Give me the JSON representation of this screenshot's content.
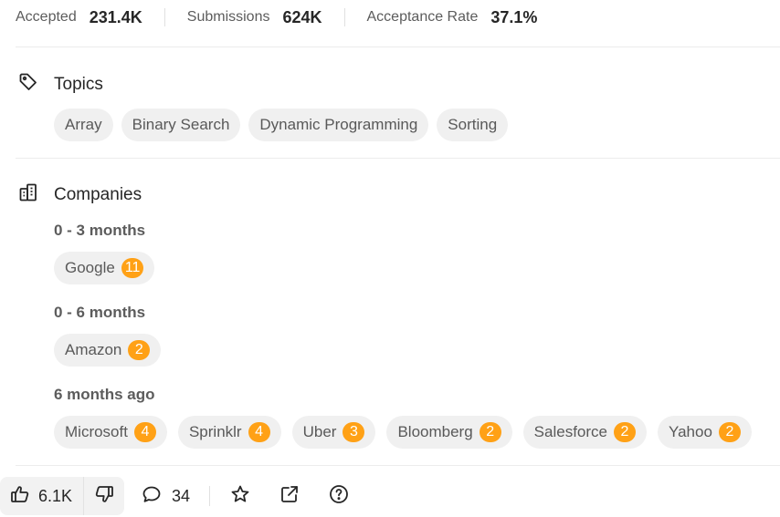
{
  "stats": [
    {
      "label": "Accepted",
      "value": "231.4K"
    },
    {
      "label": "Submissions",
      "value": "624K"
    },
    {
      "label": "Acceptance Rate",
      "value": "37.1%"
    }
  ],
  "topics": {
    "title": "Topics",
    "icon": "tag-icon",
    "tags": [
      "Array",
      "Binary Search",
      "Dynamic Programming",
      "Sorting"
    ]
  },
  "companies": {
    "title": "Companies",
    "icon": "building-icon",
    "groups": [
      {
        "period": "0 - 3 months",
        "items": [
          {
            "name": "Google",
            "count": "11"
          }
        ]
      },
      {
        "period": "0 - 6 months",
        "items": [
          {
            "name": "Amazon",
            "count": "2"
          }
        ]
      },
      {
        "period": "6 months ago",
        "items": [
          {
            "name": "Microsoft",
            "count": "4"
          },
          {
            "name": "Sprinklr",
            "count": "4"
          },
          {
            "name": "Uber",
            "count": "3"
          },
          {
            "name": "Bloomberg",
            "count": "2"
          },
          {
            "name": "Salesforce",
            "count": "2"
          },
          {
            "name": "Yahoo",
            "count": "2"
          }
        ]
      }
    ]
  },
  "actions": {
    "likes": "6.1K",
    "comments": "34",
    "icons": [
      "thumbs-up-icon",
      "thumbs-down-icon",
      "comment-icon",
      "star-icon",
      "share-icon",
      "help-icon"
    ]
  },
  "colors": {
    "badge": "#ffa116",
    "chip_bg": "#f0f0f0",
    "divider": "#ececec"
  }
}
